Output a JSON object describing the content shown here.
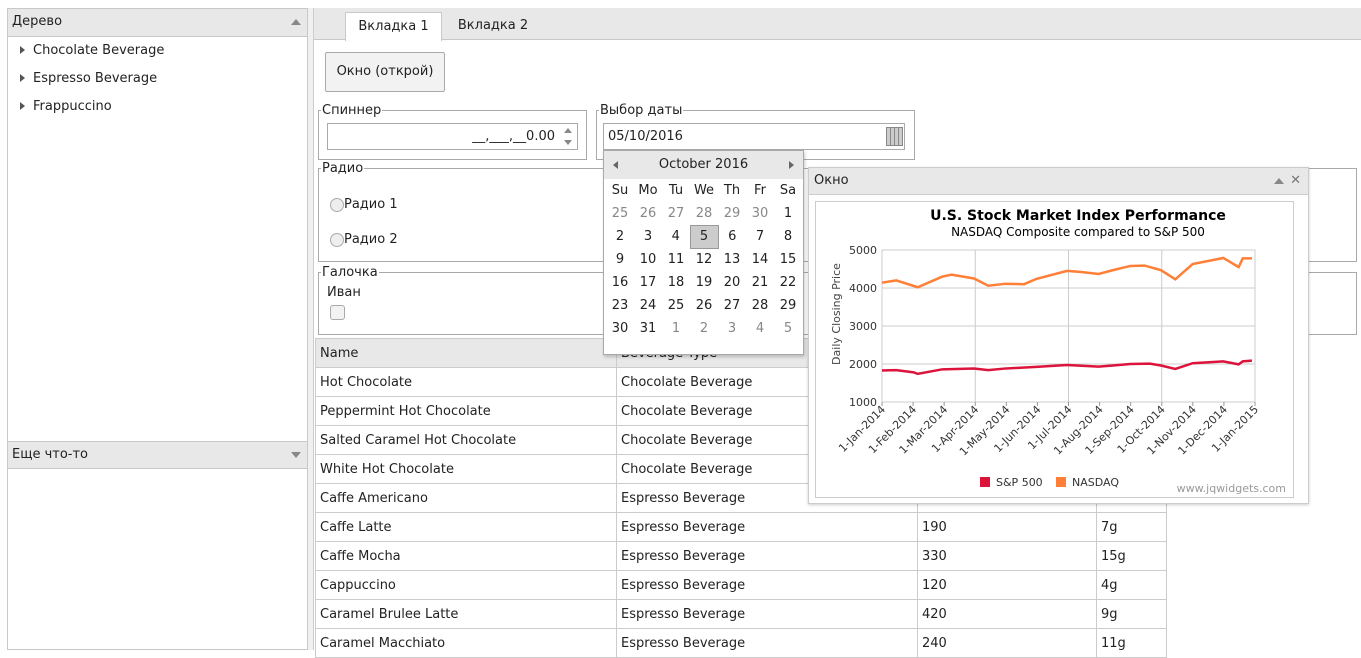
{
  "left": {
    "tree_title": "Дерево",
    "tree_items": [
      "Chocolate Beverage",
      "Espresso Beverage",
      "Frappuccino"
    ],
    "bottom_title": "Еще что-то"
  },
  "tabs": [
    "Вкладка 1",
    "Вкладка 2"
  ],
  "open_window_button": "Окно (открой)",
  "spinner": {
    "legend": "Спиннер",
    "value": "__,___,__0.00"
  },
  "datepicker": {
    "legend": "Выбор даты",
    "value": "05/10/2016"
  },
  "radio": {
    "legend": "Радио",
    "options": [
      "Радио 1",
      "Радио 2"
    ]
  },
  "checkbox": {
    "legend": "Галочка",
    "label": "Иван"
  },
  "calendar": {
    "month": "October 2016",
    "weekdays": [
      "Su",
      "Mo",
      "Tu",
      "We",
      "Th",
      "Fr",
      "Sa"
    ],
    "weeks": [
      [
        "25",
        "26",
        "27",
        "28",
        "29",
        "30",
        "1"
      ],
      [
        "2",
        "3",
        "4",
        "5",
        "6",
        "7",
        "8"
      ],
      [
        "9",
        "10",
        "11",
        "12",
        "13",
        "14",
        "15"
      ],
      [
        "16",
        "17",
        "18",
        "19",
        "20",
        "21",
        "22"
      ],
      [
        "23",
        "24",
        "25",
        "26",
        "27",
        "28",
        "29"
      ],
      [
        "30",
        "31",
        "1",
        "2",
        "3",
        "4",
        "5"
      ]
    ],
    "selected": "5"
  },
  "table": {
    "headers": [
      "Name",
      "Beverage Type"
    ],
    "rows": [
      [
        "Hot Chocolate",
        "Chocolate Beverage",
        "",
        ""
      ],
      [
        "Peppermint Hot Chocolate",
        "Chocolate Beverage",
        "",
        ""
      ],
      [
        "Salted Caramel Hot Chocolate",
        "Chocolate Beverage",
        "",
        ""
      ],
      [
        "White Hot Chocolate",
        "Chocolate Beverage",
        "",
        ""
      ],
      [
        "Caffe Americano",
        "Espresso Beverage",
        "",
        ""
      ],
      [
        "Caffe Latte",
        "Espresso Beverage",
        "190",
        "7g"
      ],
      [
        "Caffe Mocha",
        "Espresso Beverage",
        "330",
        "15g"
      ],
      [
        "Cappuccino",
        "Espresso Beverage",
        "120",
        "4g"
      ],
      [
        "Caramel Brulee Latte",
        "Espresso Beverage",
        "420",
        "9g"
      ],
      [
        "Caramel Macchiato",
        "Espresso Beverage",
        "240",
        "11g"
      ]
    ]
  },
  "window": {
    "title": "Окно",
    "watermark": "www.jqwidgets.com"
  },
  "chart_data": {
    "type": "line",
    "title": "U.S. Stock Market Index Performance",
    "subtitle": "NASDAQ Composite compared to S&P 500",
    "ylabel": "Daily Closing Price",
    "ylim": [
      1000,
      5000
    ],
    "yticks": [
      "5000",
      "4000",
      "3000",
      "2000",
      "1000"
    ],
    "xticks": [
      "1-Jan-2014",
      "1-Feb-2014",
      "1-Mar-2014",
      "1-Apr-2014",
      "1-May-2014",
      "1-Jun-2014",
      "1-Jul-2014",
      "1-Aug-2014",
      "1-Sep-2014",
      "1-Oct-2014",
      "1-Nov-2014",
      "1-Dec-2014",
      "1-Jan-2015"
    ],
    "grid": true,
    "legend": "bottom",
    "series": [
      {
        "name": "S&P 500",
        "color": "#dc143c",
        "x": [
          "2014-01-01",
          "2014-01-15",
          "2014-02-01",
          "2014-02-05",
          "2014-03-01",
          "2014-04-01",
          "2014-04-15",
          "2014-05-01",
          "2014-06-01",
          "2014-07-01",
          "2014-08-01",
          "2014-08-15",
          "2014-09-01",
          "2014-09-20",
          "2014-10-01",
          "2014-10-15",
          "2014-11-01",
          "2014-12-01",
          "2014-12-16",
          "2014-12-20",
          "2014-12-29"
        ],
        "values": [
          1830,
          1840,
          1780,
          1740,
          1860,
          1880,
          1840,
          1880,
          1925,
          1975,
          1930,
          1960,
          2000,
          2010,
          1960,
          1870,
          2020,
          2070,
          1990,
          2070,
          2090
        ]
      },
      {
        "name": "NASDAQ",
        "color": "#ff7f37",
        "x": [
          "2014-01-01",
          "2014-01-15",
          "2014-02-05",
          "2014-03-01",
          "2014-03-10",
          "2014-04-01",
          "2014-04-15",
          "2014-05-01",
          "2014-05-20",
          "2014-06-01",
          "2014-07-01",
          "2014-07-15",
          "2014-08-01",
          "2014-08-15",
          "2014-09-01",
          "2014-09-15",
          "2014-10-01",
          "2014-10-15",
          "2014-11-01",
          "2014-12-01",
          "2014-12-16",
          "2014-12-20",
          "2014-12-29"
        ],
        "values": [
          4140,
          4200,
          4020,
          4300,
          4350,
          4250,
          4060,
          4110,
          4100,
          4240,
          4450,
          4420,
          4370,
          4470,
          4580,
          4590,
          4470,
          4230,
          4630,
          4790,
          4550,
          4780,
          4780
        ]
      }
    ]
  }
}
